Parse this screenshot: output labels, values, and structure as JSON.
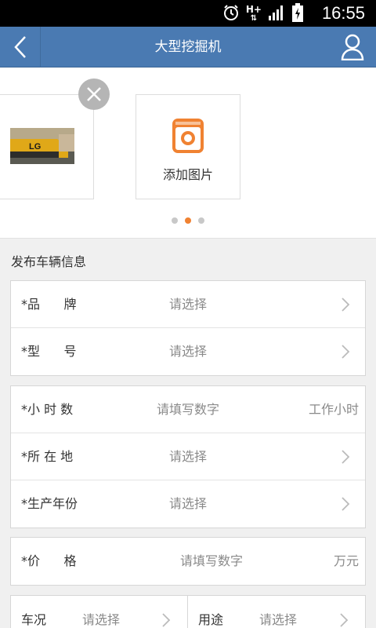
{
  "status": {
    "time": "16:55",
    "network": "H+",
    "icons": [
      "alarm-icon",
      "network-hplus-icon",
      "signal-icon",
      "battery-charging-icon"
    ]
  },
  "appbar": {
    "title": "大型挖掘机",
    "back_icon": "back-chevron-icon",
    "user_icon": "user-icon",
    "color": "#4a7ab2"
  },
  "gallery": {
    "photo_alt": "挖掘机照片",
    "photo_logo_text": "LG",
    "add_label": "添加图片",
    "pages": 3,
    "active_page": 2,
    "accent": "#f08232"
  },
  "section_title": "发布车辆信息",
  "form": {
    "group1": [
      {
        "label": "*品      牌",
        "value": "请选择"
      },
      {
        "label": "*型      号",
        "value": "请选择"
      }
    ],
    "group2": [
      {
        "label": "*小 时 数",
        "value": "请填写数字",
        "unit": "工作小时"
      },
      {
        "label": "*所 在 地",
        "value": "请选择"
      },
      {
        "label": "*生产年份",
        "value": "请选择"
      }
    ],
    "group3": [
      {
        "label": "*价      格",
        "value": "请填写数字",
        "unit": "万元"
      }
    ],
    "split": {
      "left": {
        "label": "车况",
        "value": "请选择"
      },
      "right": {
        "label": "用途",
        "value": "请选择"
      }
    }
  }
}
